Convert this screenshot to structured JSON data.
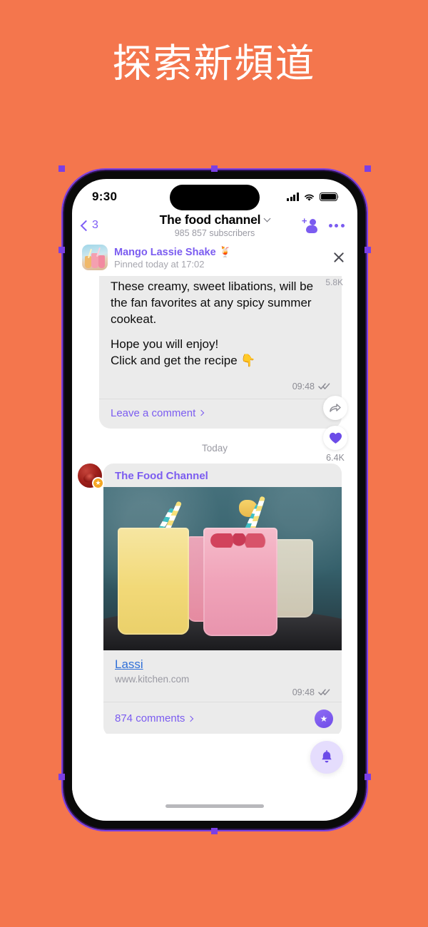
{
  "headline": "探索新頻道",
  "background_color": "#f4764d",
  "accent_color": "#7b5cf0",
  "phone": {
    "status_bar": {
      "time": "9:30",
      "signal_icon": "cellular-signal-icon",
      "wifi_icon": "wifi-icon",
      "battery_icon": "battery-full-icon"
    },
    "chat_header": {
      "back_icon": "chevron-left-icon",
      "back_count": "3",
      "title": "The food channel",
      "title_chevron_icon": "chevron-down-icon",
      "subscribers": "985 857 subscribers",
      "add_user_icon": "add-user-icon",
      "more_icon": "more-options-icon"
    },
    "pinned": {
      "thumbnail_icon": "pinned-message-thumbnail",
      "title": "Mango Lassie Shake 🍹",
      "subtitle": "Pinned today at 17:02",
      "close_icon": "close-icon"
    },
    "messages": [
      {
        "type": "text",
        "views": "5.8K",
        "paragraphs": [
          "These creamy, sweet libations, will be the fan favorites at any spicy summer cookeat.",
          "Hope you will enjoy!\nClick and get the recipe 👇"
        ],
        "time": "09:48",
        "read_icon": "double-check-icon",
        "comment_label": "Leave a comment",
        "comment_chevron_icon": "chevron-right-icon"
      }
    ],
    "day_divider": "Today",
    "media_message": {
      "avatar_icon": "channel-avatar",
      "avatar_badge_icon": "star-badge-icon",
      "channel_name": "The Food Channel",
      "photo_alt": "three-lassi-smoothie-glasses-photo",
      "link_title": "Lassi",
      "link_url": "www.kitchen.com",
      "time": "09:48",
      "read_icon": "double-check-icon",
      "comments_label": "874 comments",
      "comments_chevron_icon": "chevron-right-icon",
      "reply_avatar_icon": "star-avatar-icon"
    },
    "reactions": {
      "share_icon": "share-arrow-icon",
      "heart_icon": "heart-icon",
      "heart_count": "6.4K"
    },
    "bottom": {
      "bell_icon": "notification-bell-icon",
      "home_indicator": "home-indicator"
    }
  }
}
